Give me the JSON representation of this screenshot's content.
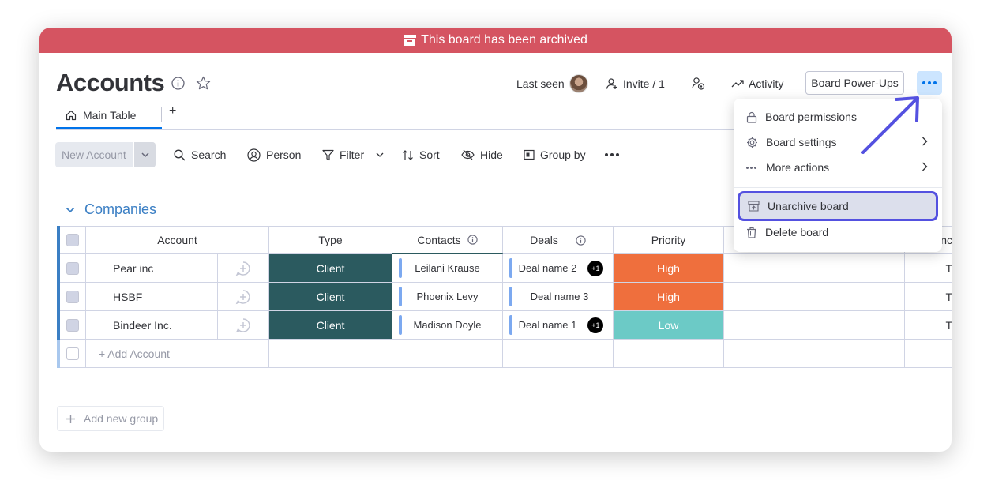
{
  "banner": {
    "text": "This board has been archived",
    "color": "#d55461"
  },
  "board": {
    "title": "Accounts"
  },
  "header": {
    "last_seen_label": "Last seen",
    "invite_label": "Invite / 1",
    "activity_label": "Activity",
    "power_ups_label": "Board Power-Ups"
  },
  "tabs": [
    {
      "label": "Main Table"
    }
  ],
  "toolbar": {
    "new_item_label": "New Account",
    "search_label": "Search",
    "person_label": "Person",
    "filter_label": "Filter",
    "sort_label": "Sort",
    "hide_label": "Hide",
    "group_by_label": "Group by"
  },
  "group": {
    "title": "Companies",
    "color": "#579bfc"
  },
  "table": {
    "columns": [
      "Account",
      "Type",
      "Contacts",
      "Deals",
      "Priority",
      "",
      "nc"
    ],
    "rows": [
      {
        "account": "Pear inc",
        "type": "Client",
        "contact": "Leilani Krause",
        "deal": "Deal name 2",
        "deal_extra": "+1",
        "priority": "High",
        "last": "T"
      },
      {
        "account": "HSBF",
        "type": "Client",
        "contact": "Phoenix Levy",
        "deal": "Deal name 3",
        "deal_extra": "",
        "priority": "High",
        "last": "T"
      },
      {
        "account": "Bindeer Inc.",
        "type": "Client",
        "contact": "Madison Doyle",
        "deal": "Deal name 1",
        "deal_extra": "+1",
        "priority": "Low",
        "last": "T"
      }
    ],
    "add_row_label": "+ Add Account"
  },
  "add_group_label": "Add new group",
  "menu": {
    "items": [
      {
        "label": "Board permissions",
        "icon": "lock-icon"
      },
      {
        "label": "Board settings",
        "icon": "gear-icon"
      },
      {
        "label": "More actions",
        "icon": "dots-icon"
      },
      {
        "label": "Unarchive board",
        "icon": "unarchive-icon"
      },
      {
        "label": "Delete board",
        "icon": "trash-icon"
      }
    ]
  },
  "colors": {
    "accent": "#0073ea",
    "type_client": "#2b5a5f",
    "priority_high": "#ef6f3d",
    "priority_low": "#6ccac6",
    "annotation": "#5451e0"
  }
}
